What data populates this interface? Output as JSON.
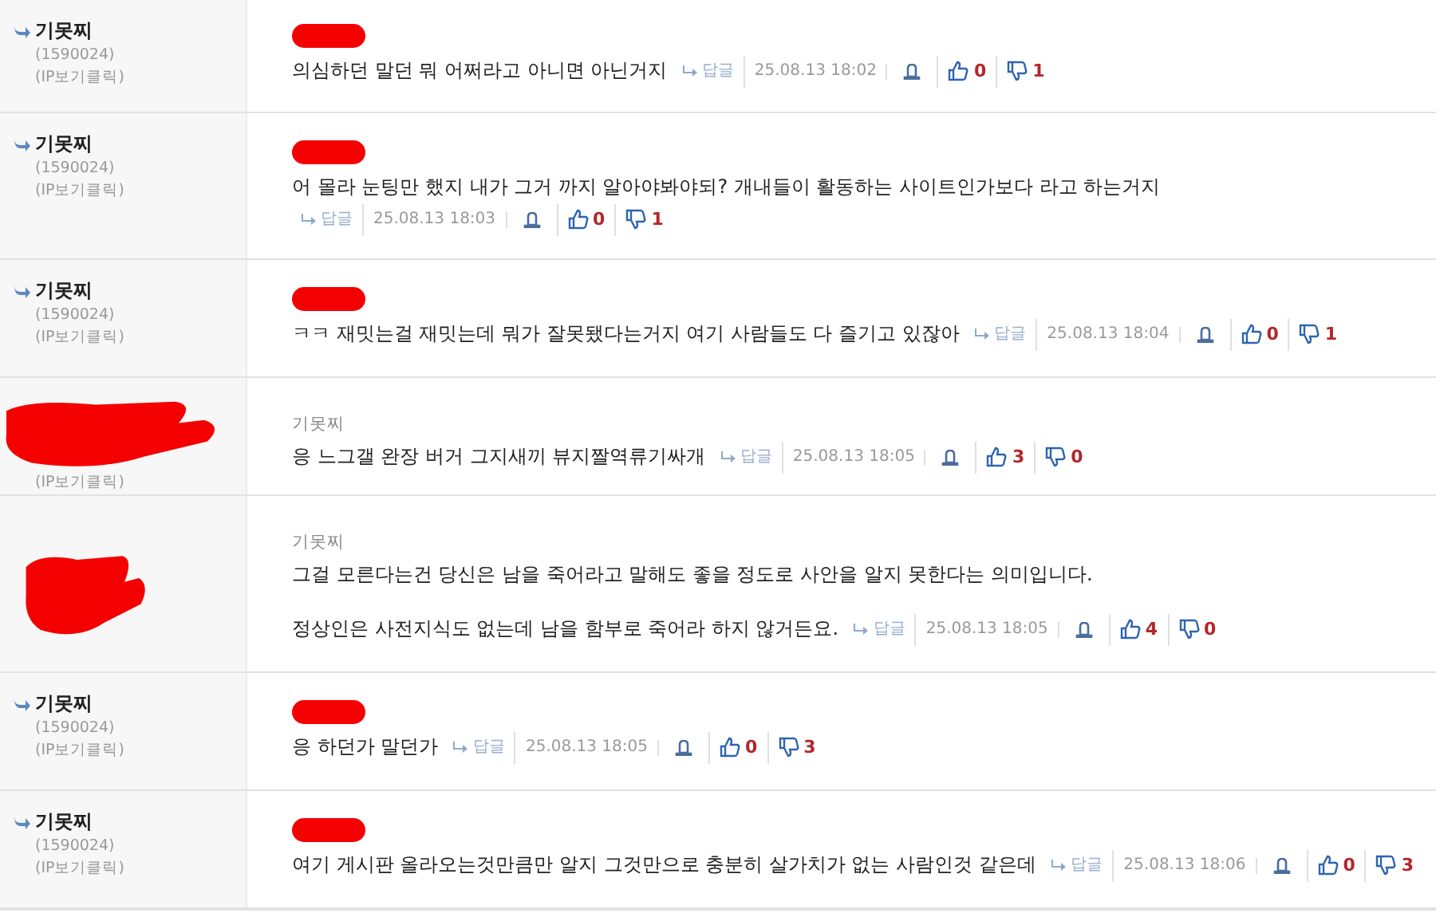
{
  "comments": [
    {
      "author": {
        "redacted": false,
        "name": "기못찌",
        "member_id": "(1590024)",
        "ip_link": "(IP보기클릭)"
      },
      "mention": {
        "redacted": true
      },
      "body": [
        "의심하던 말던 뭐 어쩌라고 아니면 아닌거지"
      ],
      "reply": "답글",
      "date": "25.08.13 18:02",
      "likes": "0",
      "dislikes": "1"
    },
    {
      "author": {
        "redacted": false,
        "name": "기못찌",
        "member_id": "(1590024)",
        "ip_link": "(IP보기클릭)"
      },
      "mention": {
        "redacted": true
      },
      "body": [
        "어 몰라 눈팅만 했지 내가 그거 까지 알아야봐야되? 개내들이 활동하는 사이트인가보다 라고 하는거지"
      ],
      "reply": "답글",
      "date": "25.08.13 18:03",
      "likes": "0",
      "dislikes": "1"
    },
    {
      "author": {
        "redacted": false,
        "name": "기못찌",
        "member_id": "(1590024)",
        "ip_link": "(IP보기클릭)"
      },
      "mention": {
        "redacted": true
      },
      "body": [
        "ㅋㅋ 재밋는걸 재밋는데 뭐가 잘못됐다는거지 여기 사람들도 다 즐기고 있잖아"
      ],
      "reply": "답글",
      "date": "25.08.13 18:04",
      "likes": "0",
      "dislikes": "1"
    },
    {
      "author": {
        "redacted": true,
        "ip_link": "(IP보기클릭)"
      },
      "mention": {
        "redacted": false,
        "name": "기못찌"
      },
      "body": [
        "응 느그갤 완장 버거 그지새끼 뷰지짤역류기싸개"
      ],
      "reply": "답글",
      "date": "25.08.13 18:05",
      "likes": "3",
      "dislikes": "0"
    },
    {
      "author": {
        "redacted": true
      },
      "mention": {
        "redacted": false,
        "name": "기못찌"
      },
      "body": [
        "그걸 모른다는건 당신은 남을 죽어라고 말해도 좋을 정도로 사안을 알지 못한다는 의미입니다.",
        "정상인은 사전지식도 없는데 남을 함부로 죽어라 하지 않거든요."
      ],
      "reply": "답글",
      "date": "25.08.13 18:05",
      "likes": "4",
      "dislikes": "0"
    },
    {
      "author": {
        "redacted": false,
        "name": "기못찌",
        "member_id": "(1590024)",
        "ip_link": "(IP보기클릭)"
      },
      "mention": {
        "redacted": true
      },
      "body": [
        "응 하던가 말던가"
      ],
      "reply": "답글",
      "date": "25.08.13 18:05",
      "likes": "0",
      "dislikes": "3"
    },
    {
      "author": {
        "redacted": false,
        "name": "기못찌",
        "member_id": "(1590024)",
        "ip_link": "(IP보기클릭)"
      },
      "mention": {
        "redacted": true
      },
      "body": [
        "여기 게시판 올라오는것만큼만 알지 그것만으로 충분히 살가치가 없는 사람인것 같은데"
      ],
      "reply": "답글",
      "date": "25.08.13 18:06",
      "likes": "0",
      "dislikes": "3"
    }
  ]
}
